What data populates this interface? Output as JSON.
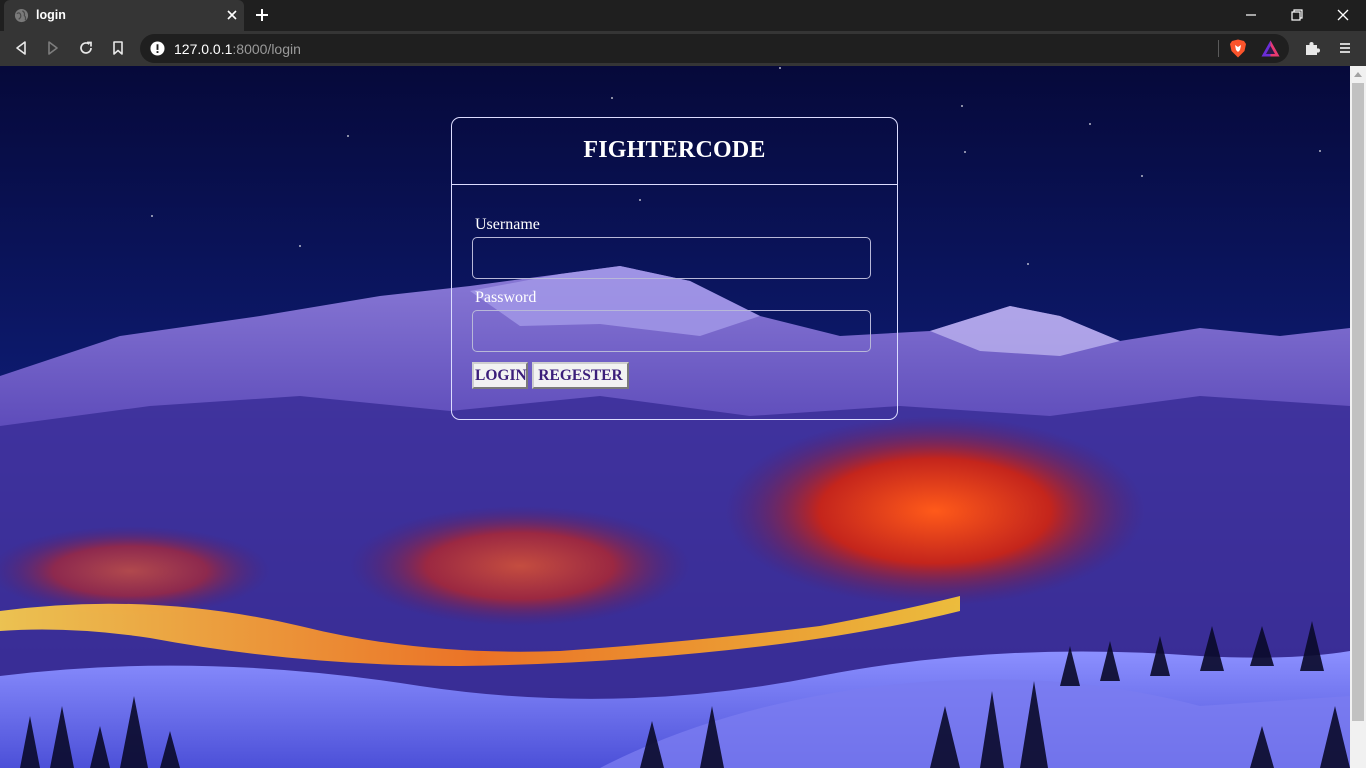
{
  "browser": {
    "tab_title": "login",
    "url_host": "127.0.0.1",
    "url_rest": ":8000/login"
  },
  "icons": {
    "favicon": "globe-icon",
    "tab_close": "close-icon",
    "new_tab": "plus-icon",
    "back": "back-arrow-icon",
    "forward": "forward-arrow-icon",
    "reload": "reload-icon",
    "bookmark": "bookmark-icon",
    "site_info": "warning-icon",
    "brave_shields": "brave-lion-icon",
    "brave_rewards": "triangle-rewards-icon",
    "extensions": "puzzle-icon",
    "menu": "hamburger-menu-icon"
  },
  "login": {
    "brand": "FIGHTERCODE",
    "username_label": "Username",
    "username_value": "",
    "password_label": "Password",
    "password_value": "",
    "login_button": "LOGIN",
    "register_button": "REGESTER"
  },
  "colors": {
    "button_text": "#3b1e7a",
    "card_border": "#dcdcff",
    "chrome_dark": "#1f1f1f",
    "chrome_mid": "#353535"
  }
}
